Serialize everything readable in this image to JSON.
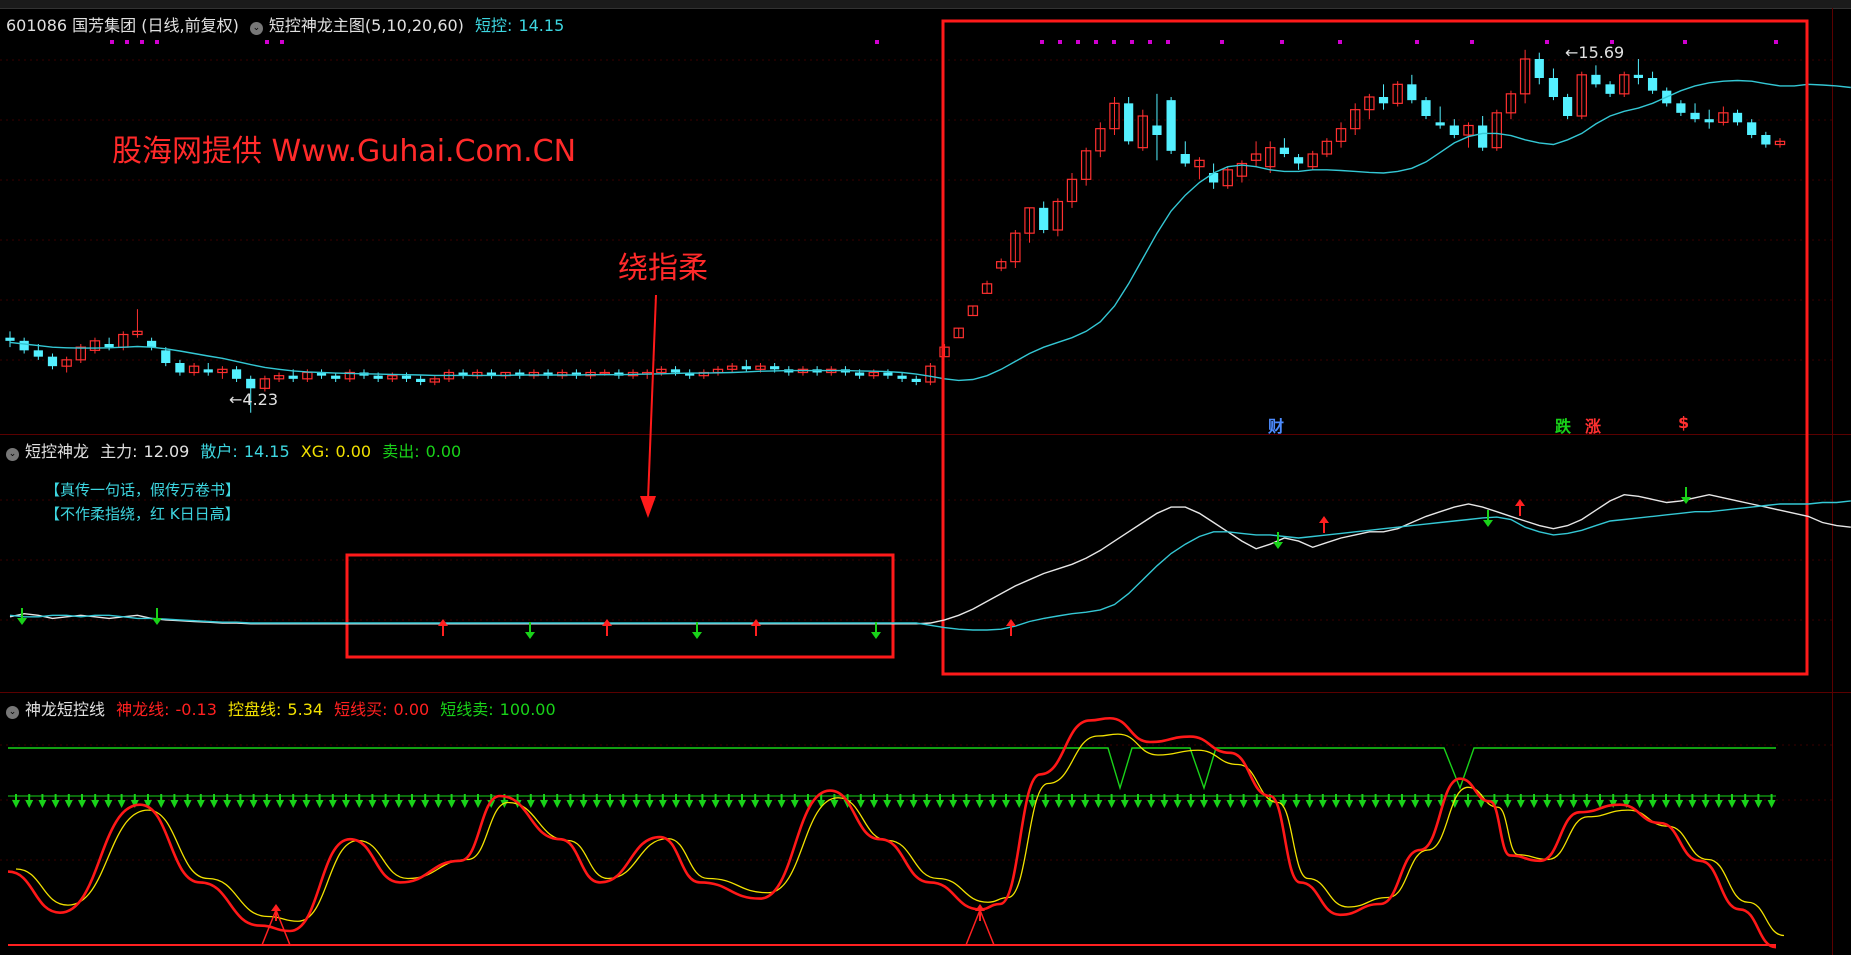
{
  "colors": {
    "up": "#ff3030",
    "down": "#54f0ff",
    "ma": "#34c7d4",
    "white_line": "#e6e6e6",
    "cyan_line": "#34c7d4",
    "green": "#19d219",
    "red": "#ff2020",
    "yellow": "#f2e100",
    "magenta": "#d000d0",
    "box": "#ff1a1a"
  },
  "main_panel": {
    "stock": "601086 国芳集团 (日线,前复权)",
    "indicator_name": "短控神龙主图(5,10,20,60)",
    "value_label": "短控:",
    "value": "14.15",
    "watermark": "股海网提供 Www.Guhai.Com.CN",
    "annotation": "绕指柔",
    "high_label": "15.69",
    "low_label": "4.23",
    "tags": [
      {
        "text": "财",
        "color": "#4d8cff"
      },
      {
        "text": "跌",
        "color": "#19d219"
      },
      {
        "text": "涨",
        "color": "#ff3030"
      },
      {
        "text": "$",
        "color": "#ff3030"
      }
    ]
  },
  "mid_panel": {
    "name": "短控神龙",
    "items": [
      {
        "label": "主力:",
        "value": "12.09"
      },
      {
        "label": "散户:",
        "value": "14.15"
      },
      {
        "label": "XG:",
        "value": "0.00"
      },
      {
        "label": "卖出:",
        "value": "0.00"
      }
    ],
    "note1": "【真传一句话，假传万卷书】",
    "note2": "【不作柔指绕，红 K日日高】"
  },
  "bottom_panel": {
    "name": "神龙短控线",
    "items": [
      {
        "label": "神龙线:",
        "value": "-0.13"
      },
      {
        "label": "控盘线:",
        "value": "5.34"
      },
      {
        "label": "短线买:",
        "value": "0.00"
      },
      {
        "label": "短线卖:",
        "value": "100.00"
      }
    ]
  },
  "chart_data": [
    {
      "type": "candlestick",
      "ylim": [
        4.0,
        16.0
      ],
      "candles": [
        [
          6.6,
          6.8,
          6.3,
          6.5
        ],
        [
          6.5,
          6.6,
          6.1,
          6.2
        ],
        [
          6.2,
          6.4,
          5.9,
          6.0
        ],
        [
          6.0,
          6.1,
          5.6,
          5.7
        ],
        [
          5.7,
          6.0,
          5.5,
          5.9
        ],
        [
          5.9,
          6.4,
          5.8,
          6.3
        ],
        [
          6.2,
          6.6,
          6.1,
          6.5
        ],
        [
          6.4,
          6.6,
          6.2,
          6.3
        ],
        [
          6.3,
          6.8,
          6.2,
          6.7
        ],
        [
          6.7,
          7.5,
          6.6,
          6.8
        ],
        [
          6.5,
          6.6,
          6.2,
          6.3
        ],
        [
          6.2,
          6.3,
          5.7,
          5.8
        ],
        [
          5.8,
          5.9,
          5.4,
          5.5
        ],
        [
          5.5,
          5.8,
          5.4,
          5.7
        ],
        [
          5.6,
          5.8,
          5.4,
          5.5
        ],
        [
          5.5,
          5.7,
          5.3,
          5.6
        ],
        [
          5.6,
          5.7,
          5.2,
          5.3
        ],
        [
          5.3,
          5.4,
          4.23,
          5.0
        ],
        [
          5.0,
          5.4,
          4.9,
          5.3
        ],
        [
          5.3,
          5.5,
          5.2,
          5.4
        ],
        [
          5.4,
          5.6,
          5.2,
          5.3
        ],
        [
          5.3,
          5.6,
          5.2,
          5.5
        ],
        [
          5.5,
          5.6,
          5.3,
          5.4
        ],
        [
          5.4,
          5.5,
          5.2,
          5.3
        ],
        [
          5.3,
          5.6,
          5.2,
          5.5
        ],
        [
          5.5,
          5.6,
          5.3,
          5.4
        ],
        [
          5.4,
          5.5,
          5.2,
          5.3
        ],
        [
          5.3,
          5.5,
          5.2,
          5.4
        ],
        [
          5.4,
          5.5,
          5.2,
          5.3
        ],
        [
          5.3,
          5.4,
          5.1,
          5.2
        ],
        [
          5.2,
          5.4,
          5.1,
          5.3
        ],
        [
          5.3,
          5.6,
          5.2,
          5.5
        ],
        [
          5.5,
          5.6,
          5.3,
          5.4
        ],
        [
          5.4,
          5.6,
          5.3,
          5.5
        ],
        [
          5.5,
          5.6,
          5.3,
          5.4
        ],
        [
          5.4,
          5.5,
          5.3,
          5.5
        ],
        [
          5.5,
          5.6,
          5.3,
          5.4
        ],
        [
          5.4,
          5.6,
          5.3,
          5.5
        ],
        [
          5.5,
          5.6,
          5.3,
          5.4
        ],
        [
          5.4,
          5.6,
          5.3,
          5.5
        ],
        [
          5.5,
          5.6,
          5.3,
          5.4
        ],
        [
          5.4,
          5.6,
          5.3,
          5.5
        ],
        [
          5.5,
          5.6,
          5.4,
          5.5
        ],
        [
          5.5,
          5.6,
          5.3,
          5.4
        ],
        [
          5.4,
          5.6,
          5.3,
          5.5
        ],
        [
          5.5,
          5.6,
          5.3,
          5.5
        ],
        [
          5.5,
          5.7,
          5.4,
          5.6
        ],
        [
          5.6,
          5.7,
          5.4,
          5.5
        ],
        [
          5.5,
          5.6,
          5.3,
          5.4
        ],
        [
          5.4,
          5.6,
          5.3,
          5.5
        ],
        [
          5.5,
          5.7,
          5.4,
          5.6
        ],
        [
          5.6,
          5.8,
          5.5,
          5.7
        ],
        [
          5.7,
          5.9,
          5.5,
          5.6
        ],
        [
          5.6,
          5.8,
          5.5,
          5.7
        ],
        [
          5.7,
          5.8,
          5.5,
          5.6
        ],
        [
          5.6,
          5.7,
          5.4,
          5.5
        ],
        [
          5.5,
          5.7,
          5.4,
          5.6
        ],
        [
          5.6,
          5.7,
          5.4,
          5.5
        ],
        [
          5.5,
          5.7,
          5.4,
          5.6
        ],
        [
          5.6,
          5.7,
          5.4,
          5.5
        ],
        [
          5.5,
          5.6,
          5.3,
          5.4
        ],
        [
          5.4,
          5.6,
          5.3,
          5.5
        ],
        [
          5.5,
          5.6,
          5.3,
          5.4
        ],
        [
          5.4,
          5.5,
          5.2,
          5.3
        ],
        [
          5.3,
          5.4,
          5.1,
          5.2
        ],
        [
          5.2,
          5.8,
          5.1,
          5.7
        ],
        [
          6.0,
          6.4,
          6.0,
          6.3
        ],
        [
          6.6,
          6.9,
          6.6,
          6.9
        ],
        [
          7.3,
          7.6,
          7.3,
          7.6
        ],
        [
          8.0,
          8.4,
          8.0,
          8.3
        ],
        [
          8.8,
          9.1,
          8.7,
          9.0
        ],
        [
          9.0,
          10.0,
          8.8,
          9.9
        ],
        [
          9.9,
          10.7,
          9.6,
          10.7
        ],
        [
          10.7,
          10.9,
          9.9,
          10.0
        ],
        [
          10.0,
          11.0,
          9.8,
          10.9
        ],
        [
          10.9,
          11.8,
          10.7,
          11.6
        ],
        [
          11.6,
          12.6,
          11.4,
          12.5
        ],
        [
          12.5,
          13.4,
          12.3,
          13.2
        ],
        [
          13.2,
          14.2,
          13.0,
          14.0
        ],
        [
          14.0,
          14.2,
          12.7,
          12.8
        ],
        [
          12.6,
          13.8,
          12.5,
          13.6
        ],
        [
          13.3,
          14.3,
          12.2,
          13.0
        ],
        [
          14.1,
          14.2,
          12.4,
          12.5
        ],
        [
          12.4,
          12.8,
          12.0,
          12.1
        ],
        [
          12.0,
          12.3,
          11.6,
          12.2
        ],
        [
          11.8,
          12.1,
          11.3,
          11.5
        ],
        [
          11.4,
          12.0,
          11.3,
          11.9
        ],
        [
          11.7,
          12.2,
          11.5,
          12.1
        ],
        [
          12.2,
          12.8,
          12.0,
          12.4
        ],
        [
          12.0,
          12.8,
          11.8,
          12.6
        ],
        [
          12.6,
          12.9,
          12.3,
          12.4
        ],
        [
          12.3,
          12.4,
          11.9,
          12.1
        ],
        [
          12.0,
          12.5,
          11.9,
          12.4
        ],
        [
          12.4,
          12.9,
          12.3,
          12.8
        ],
        [
          12.8,
          13.4,
          12.6,
          13.2
        ],
        [
          13.2,
          14.0,
          13.0,
          13.8
        ],
        [
          13.8,
          14.3,
          13.5,
          14.2
        ],
        [
          14.2,
          14.6,
          13.8,
          14.0
        ],
        [
          14.0,
          14.7,
          13.9,
          14.6
        ],
        [
          14.6,
          14.9,
          14.0,
          14.1
        ],
        [
          14.1,
          14.2,
          13.5,
          13.6
        ],
        [
          13.4,
          13.9,
          13.2,
          13.3
        ],
        [
          13.3,
          13.5,
          12.9,
          13.0
        ],
        [
          13.0,
          13.4,
          12.6,
          13.3
        ],
        [
          13.3,
          13.6,
          12.5,
          12.6
        ],
        [
          12.6,
          13.8,
          12.5,
          13.7
        ],
        [
          13.7,
          14.4,
          13.5,
          14.3
        ],
        [
          14.3,
          15.69,
          14.0,
          15.4
        ],
        [
          15.4,
          15.6,
          14.6,
          14.8
        ],
        [
          14.8,
          15.1,
          14.1,
          14.2
        ],
        [
          14.2,
          14.3,
          13.5,
          13.6
        ],
        [
          13.6,
          15.0,
          13.5,
          14.9
        ],
        [
          14.9,
          15.2,
          14.5,
          14.6
        ],
        [
          14.6,
          14.7,
          14.2,
          14.3
        ],
        [
          14.3,
          15.0,
          14.2,
          14.9
        ],
        [
          14.9,
          15.4,
          14.6,
          14.8
        ],
        [
          14.8,
          15.0,
          14.3,
          14.4
        ],
        [
          14.4,
          14.5,
          13.9,
          14.0
        ],
        [
          14.0,
          14.1,
          13.6,
          13.7
        ],
        [
          13.7,
          14.0,
          13.4,
          13.5
        ],
        [
          13.5,
          13.8,
          13.2,
          13.4
        ],
        [
          13.4,
          13.9,
          13.3,
          13.7
        ],
        [
          13.7,
          13.8,
          13.3,
          13.4
        ],
        [
          13.4,
          13.5,
          12.9,
          13.0
        ],
        [
          13.0,
          13.1,
          12.6,
          12.7
        ],
        [
          12.7,
          12.9,
          12.6,
          12.8
        ]
      ],
      "ma": [
        6.45,
        6.4,
        6.35,
        6.3,
        6.28,
        6.27,
        6.27,
        6.28,
        6.3,
        6.32,
        6.3,
        6.25,
        6.18,
        6.1,
        6.02,
        5.95,
        5.85,
        5.75,
        5.66,
        5.6,
        5.55,
        5.52,
        5.5,
        5.48,
        5.47,
        5.46,
        5.45,
        5.44,
        5.43,
        5.42,
        5.41,
        5.41,
        5.41,
        5.41,
        5.41,
        5.41,
        5.42,
        5.42,
        5.42,
        5.42,
        5.42,
        5.43,
        5.43,
        5.43,
        5.44,
        5.45,
        5.46,
        5.47,
        5.48,
        5.48,
        5.49,
        5.5,
        5.52,
        5.54,
        5.55,
        5.56,
        5.56,
        5.56,
        5.56,
        5.56,
        5.55,
        5.54,
        5.53,
        5.5,
        5.45,
        5.38,
        5.3,
        5.25,
        5.28,
        5.4,
        5.6,
        5.85,
        6.1,
        6.3,
        6.45,
        6.6,
        6.8,
        7.1,
        7.6,
        8.3,
        9.1,
        9.9,
        10.6,
        11.1,
        11.5,
        11.8,
        12.0,
        12.05,
        12.0,
        11.9,
        11.85,
        11.85,
        11.9,
        11.9,
        11.88,
        11.85,
        11.82,
        11.8,
        11.85,
        11.95,
        12.15,
        12.45,
        12.75,
        12.95,
        13.05,
        13.05,
        12.98,
        12.85,
        12.75,
        12.7,
        12.85,
        13.05,
        13.35,
        13.6,
        13.75,
        13.85,
        14.0,
        14.2,
        14.4,
        14.55,
        14.65,
        14.7,
        14.72,
        14.7,
        14.62,
        14.55,
        14.55,
        14.6,
        14.58,
        14.55,
        14.5
      ],
      "dots_top": 24,
      "labels": [
        "15.69",
        "4.23"
      ]
    },
    {
      "type": "line",
      "series": [
        {
          "name": "主力",
          "values": [
            0.5,
            0.7,
            0.6,
            0.4,
            0.5,
            0.6,
            0.5,
            0.4,
            0.5,
            0.6,
            0.4,
            0.3,
            0.25,
            0.2,
            0.15,
            0.1,
            0.1,
            0.05,
            0.05,
            0.05,
            0.05,
            0.05,
            0.05,
            0.05,
            0.05,
            0.05,
            0.05,
            0.05,
            0.05,
            0.05,
            0.05,
            0.05,
            0.05,
            0.05,
            0.05,
            0.05,
            0.05,
            0.05,
            0.05,
            0.05,
            0.05,
            0.05,
            0.05,
            0.05,
            0.05,
            0.05,
            0.05,
            0.05,
            0.05,
            0.05,
            0.05,
            0.05,
            0.05,
            0.05,
            0.05,
            0.05,
            0.05,
            0.05,
            0.05,
            0.05,
            0.05,
            0.05,
            0.05,
            0.05,
            0.05,
            0.1,
            0.3,
            0.6,
            1.0,
            1.5,
            2.0,
            2.5,
            2.9,
            3.3,
            3.6,
            3.9,
            4.3,
            4.8,
            5.4,
            6.0,
            6.6,
            7.2,
            7.6,
            7.6,
            7.2,
            6.6,
            6.0,
            5.4,
            4.9,
            5.2,
            5.6,
            5.4,
            5.0,
            5.3,
            5.6,
            5.8,
            6.0,
            6.0,
            6.2,
            6.6,
            7.0,
            7.3,
            7.6,
            7.8,
            7.6,
            7.3,
            7.0,
            6.7,
            6.4,
            6.2,
            6.4,
            6.8,
            7.4,
            8.0,
            8.4,
            8.3,
            8.1,
            7.9,
            8.0,
            8.2,
            8.4,
            8.2,
            8.0,
            7.8,
            7.6,
            7.4,
            7.2,
            7.0,
            6.6,
            6.4,
            6.3
          ]
        },
        {
          "name": "散户",
          "values": [
            0.6,
            0.5,
            0.5,
            0.6,
            0.6,
            0.5,
            0.6,
            0.6,
            0.5,
            0.4,
            0.4,
            0.35,
            0.3,
            0.25,
            0.2,
            0.15,
            0.15,
            0.1,
            0.1,
            0.1,
            0.1,
            0.1,
            0.1,
            0.1,
            0.1,
            0.1,
            0.1,
            0.1,
            0.1,
            0.1,
            0.1,
            0.1,
            0.1,
            0.1,
            0.1,
            0.1,
            0.1,
            0.1,
            0.1,
            0.1,
            0.1,
            0.1,
            0.1,
            0.1,
            0.1,
            0.1,
            0.1,
            0.1,
            0.1,
            0.1,
            0.1,
            0.1,
            0.1,
            0.1,
            0.1,
            0.1,
            0.1,
            0.1,
            0.1,
            0.1,
            0.1,
            0.1,
            0.1,
            0.1,
            0.1,
            -0.05,
            -0.2,
            -0.3,
            -0.35,
            -0.35,
            -0.3,
            -0.1,
            0.2,
            0.4,
            0.55,
            0.7,
            0.8,
            0.95,
            1.3,
            2.0,
            2.9,
            3.8,
            4.6,
            5.2,
            5.7,
            6.0,
            6.0,
            5.9,
            5.8,
            5.8,
            5.7,
            5.6,
            5.7,
            5.8,
            5.9,
            6.0,
            6.1,
            6.2,
            6.3,
            6.4,
            6.5,
            6.6,
            6.7,
            6.8,
            6.9,
            6.95,
            6.8,
            6.3,
            6.0,
            5.8,
            5.9,
            6.1,
            6.4,
            6.7,
            6.8,
            6.9,
            7.0,
            7.1,
            7.2,
            7.3,
            7.3,
            7.4,
            7.5,
            7.6,
            7.7,
            7.8,
            7.8,
            7.8,
            7.9,
            7.9,
            8.0
          ]
        }
      ],
      "ylim": [
        -1,
        10
      ]
    },
    {
      "type": "line",
      "series": [
        {
          "name": "神龙线"
        },
        {
          "name": "控盘线"
        },
        {
          "name": "短线买"
        },
        {
          "name": "短线卖"
        }
      ],
      "ylim": [
        -5,
        110
      ]
    }
  ]
}
